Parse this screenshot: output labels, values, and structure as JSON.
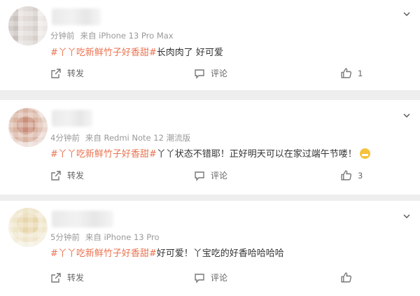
{
  "comments": [
    {
      "meta_time": "分钟前",
      "meta_device": "来自 iPhone 13 Pro Max",
      "hashtag": "#丫丫吃新鲜竹子好香甜#",
      "text": "长肉肉了 好可爱",
      "has_emoji": false,
      "actions": {
        "share": "转发",
        "comment": "评论",
        "like_count": "1"
      }
    },
    {
      "meta_time": "4分钟前",
      "meta_device": "来自 Redmi Note 12 潮流版",
      "hashtag": "#丫丫吃新鲜竹子好香甜#",
      "text": "丫丫状态不错耶！正好明天可以在家过端午节喽！",
      "has_emoji": true,
      "actions": {
        "share": "转发",
        "comment": "评论",
        "like_count": "3"
      }
    },
    {
      "meta_time": "5分钟前",
      "meta_device": "来自 iPhone 13 Pro",
      "hashtag": "#丫丫吃新鲜竹子好香甜#",
      "text": "好可爱！丫宝吃的好香哈哈哈哈",
      "has_emoji": false,
      "actions": {
        "share": "转发",
        "comment": "评论",
        "like_count": ""
      }
    }
  ],
  "icons": {
    "more": "chevron-down-icon",
    "share": "share-icon",
    "comment": "comment-icon",
    "like": "thumbs-up-icon"
  },
  "colors": {
    "hashtag": "#eb7350",
    "meta": "#999999",
    "background": "#eeeeee"
  }
}
